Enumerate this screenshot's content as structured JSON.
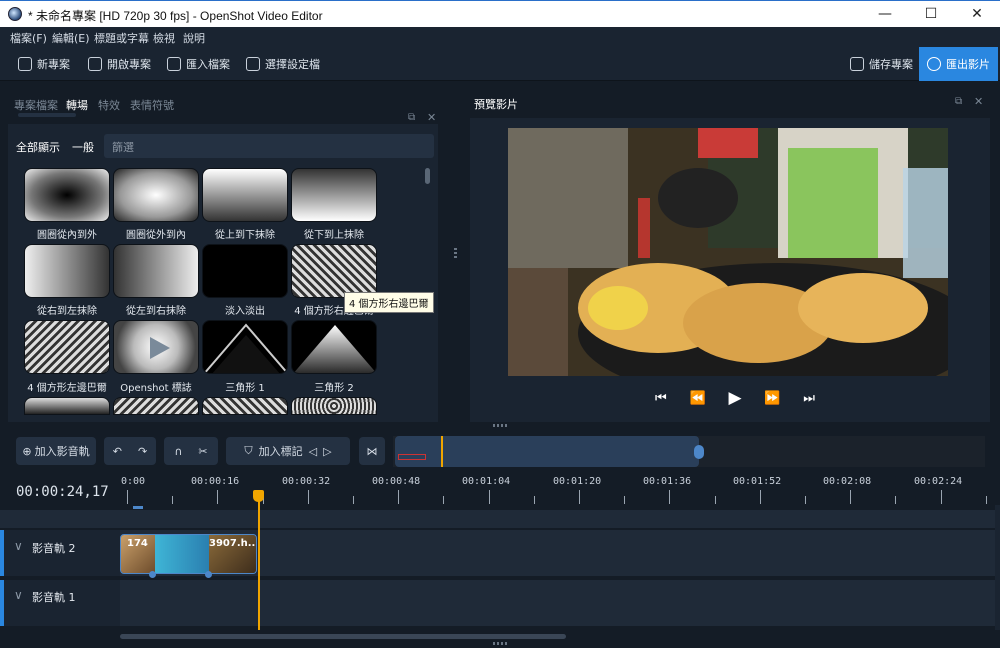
{
  "window": {
    "title": "* 未命名專案 [HD 720p 30 fps] - OpenShot Video Editor",
    "minimize": "—",
    "maximize": "☐",
    "close": "✕"
  },
  "menu": [
    "檔案(F)",
    "編輯(E)",
    "標題或字幕",
    "檢視",
    "說明"
  ],
  "toolbar": {
    "new_project": "新專案",
    "open_project": "開啟專案",
    "import_files": "匯入檔案",
    "choose_profile": "選擇設定檔",
    "save_project": "儲存專案",
    "export_video": "匯出影片"
  },
  "left_panel": {
    "tabs": [
      "專案檔案",
      "轉場",
      "特效",
      "表情符號"
    ],
    "active_tab": "轉場",
    "filter_all": "全部顯示",
    "filter_common": "一般",
    "filter_placeholder": "篩選",
    "transitions": [
      "圓圈從內到外",
      "圓圈從外到內",
      "從上到下抹除",
      "從下到上抹除",
      "從右到左抹除",
      "從左到右抹除",
      "淡入淡出",
      "4 個方形右邊巴爾",
      "4 個方形左邊巴爾",
      "Openshot 標誌",
      "三角形 1",
      "三角形 2"
    ],
    "tooltip": "4 個方形右邊巴爾"
  },
  "preview": {
    "title": "預覽影片"
  },
  "timeline": {
    "add_track": "加入影音軌",
    "add_marker": "加入標記",
    "current_time": "00:00:24,17",
    "ruler_labels": [
      "0:00",
      "00:00:16",
      "00:00:32",
      "00:00:48",
      "00:01:04",
      "00:01:20",
      "00:01:36",
      "00:01:52",
      "00:02:08",
      "00:02:24"
    ],
    "tracks": [
      {
        "name": "影音軌 2"
      },
      {
        "name": "影音軌 1"
      }
    ],
    "clip_labels": [
      "174",
      "3907.h..."
    ]
  },
  "colors": {
    "accent": "#2a87e0",
    "playhead": "#f0a500",
    "background": "#141c26",
    "panel": "#1a2431"
  }
}
